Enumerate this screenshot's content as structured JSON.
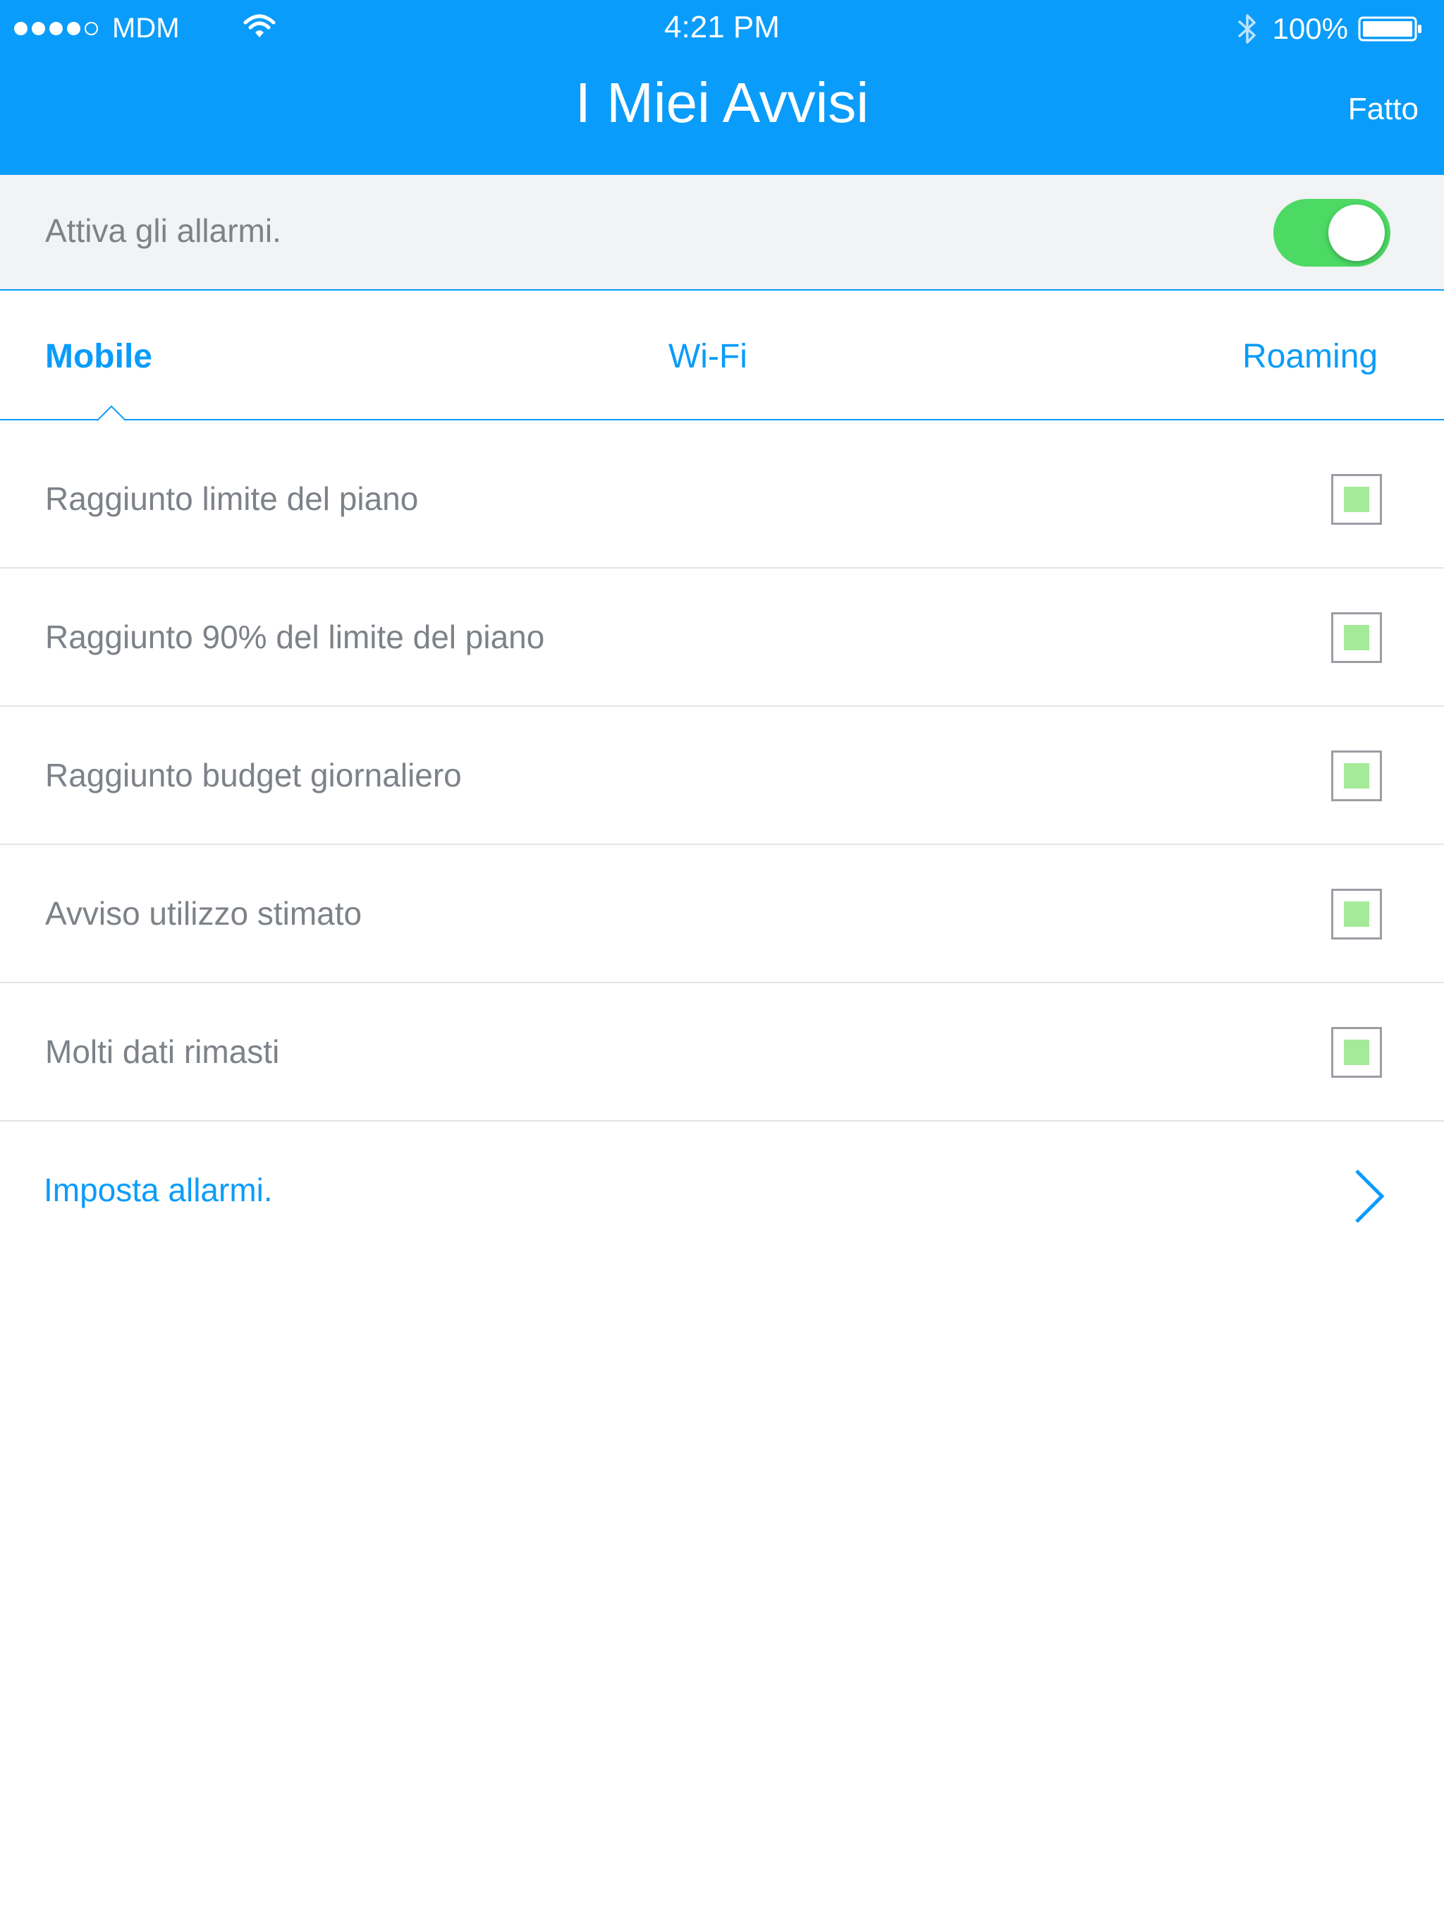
{
  "status_bar": {
    "carrier": "MDM",
    "signal_filled": 4,
    "signal_total": 5,
    "time": "4:21 PM",
    "battery": "100%",
    "icons": [
      "signal-dots-icon",
      "wifi-icon",
      "bluetooth-icon",
      "battery-icon"
    ]
  },
  "nav": {
    "title": "I Miei Avvisi",
    "done_label": "Fatto"
  },
  "alarm_toggle": {
    "label": "Attiva gli allarmi.",
    "enabled": true
  },
  "tabs": [
    {
      "label": "Mobile",
      "active": true
    },
    {
      "label": "Wi-Fi",
      "active": false
    },
    {
      "label": "Roaming",
      "active": false
    }
  ],
  "alerts": [
    {
      "label": "Raggiunto limite del piano",
      "checked": true
    },
    {
      "label": "Raggiunto 90% del limite del piano",
      "checked": true
    },
    {
      "label": "Raggiunto budget giornaliero",
      "checked": true
    },
    {
      "label": "Avviso utilizzo stimato",
      "checked": true
    },
    {
      "label": "Molti dati rimasti",
      "checked": true
    }
  ],
  "set_alarms": {
    "label": "Imposta allarmi.",
    "icon": "chevron-right-icon"
  },
  "colors": {
    "brand_blue": "#0a9cfa",
    "toggle_green": "#4cd964",
    "checkbox_fill": "#a5ea98",
    "text_gray": "#7d8288"
  }
}
